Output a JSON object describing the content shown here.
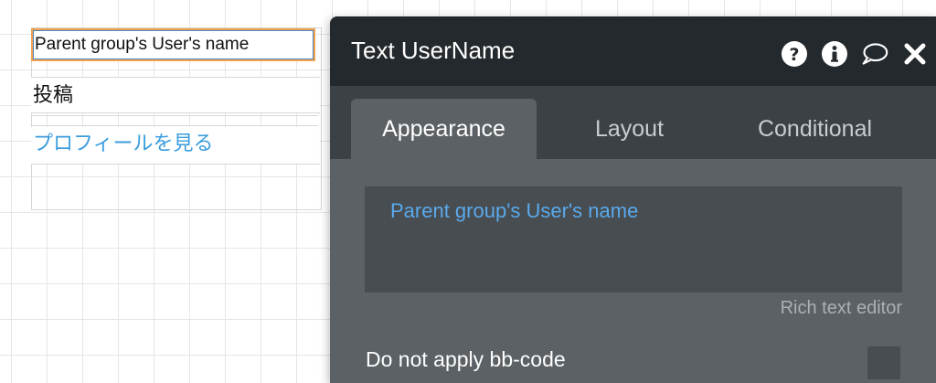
{
  "canvas": {
    "username_text": "Parent group's User's name",
    "post_text": "投稿",
    "profile_link_text": "プロフィールを見る"
  },
  "panel": {
    "title": "Text UserName",
    "header_icons": [
      "help-icon",
      "info-icon",
      "comment-icon",
      "close-icon"
    ],
    "tabs": [
      {
        "label": "Appearance",
        "active": true
      },
      {
        "label": "Layout",
        "active": false
      },
      {
        "label": "Conditional",
        "active": false
      }
    ],
    "editor": {
      "value": "Parent group's User's name",
      "caption": "Rich text editor"
    },
    "options": {
      "bbcode_label": "Do not apply bb-code",
      "bbcode_checked": false
    }
  },
  "colors": {
    "link_blue": "#3b9ddd",
    "dynamic_value_blue": "#5aa9ec",
    "selection_orange": "#f1a24c",
    "header_bg": "#24292d",
    "panel_bg": "#5b6165"
  }
}
